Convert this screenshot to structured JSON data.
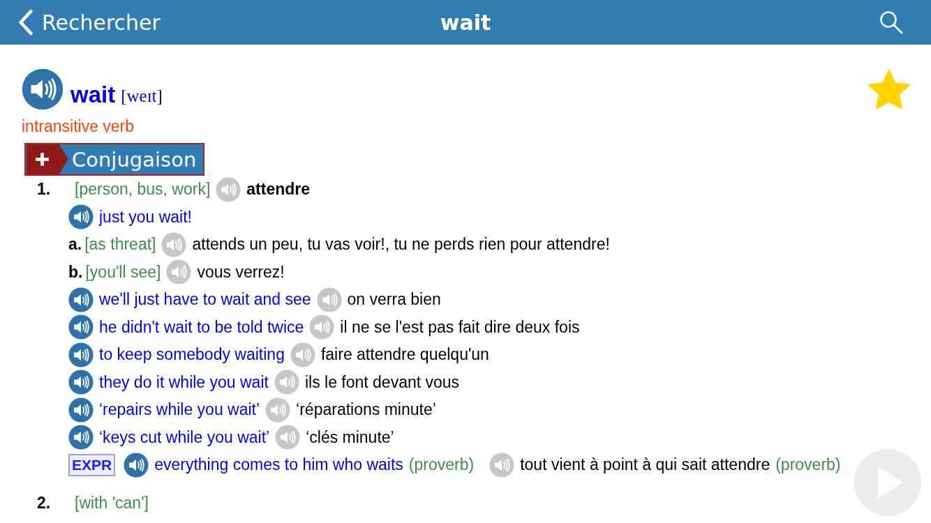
{
  "header": {
    "back_label": "Rechercher",
    "title": "wait"
  },
  "entry": {
    "headword": "wait",
    "pronunciation": "[weɪt]",
    "part_of_speech": "intransitive verb",
    "conjugation_button": "Conjugaison",
    "favorite": true
  },
  "senses": [
    {
      "number": "1.",
      "context": "[person, bus, work]",
      "translation": "attendre",
      "lines": [
        {
          "kind": "example",
          "source": "just you wait!"
        },
        {
          "kind": "sub",
          "letter": "a.",
          "context": "[as threat]",
          "translation": "attends un peu, tu vas voir!, tu ne perds rien pour attendre!"
        },
        {
          "kind": "sub",
          "letter": "b.",
          "context": "[you'll see]",
          "translation": "vous verrez!"
        },
        {
          "kind": "example",
          "source": "we'll just have to wait and see",
          "translation": "on verra bien"
        },
        {
          "kind": "example",
          "source": "he didn't wait to be told twice",
          "translation": "il ne se l'est pas fait dire deux fois"
        },
        {
          "kind": "example",
          "source": "to keep somebody waiting",
          "translation": "faire attendre quelqu'un"
        },
        {
          "kind": "example",
          "source": "they do it while you wait",
          "translation": "ils le font devant vous"
        },
        {
          "kind": "example",
          "source": "‘repairs while you wait’",
          "translation": "‘réparations minute’"
        },
        {
          "kind": "example",
          "source": "‘keys cut while you wait’",
          "translation": "‘clés minute’"
        },
        {
          "kind": "expression",
          "badge": "EXPR",
          "source": "everything comes to him who waits",
          "source_note": "(proverb)",
          "translation": "tout vient à point à qui sait attendre",
          "translation_note": "(proverb)"
        }
      ]
    },
    {
      "number": "2.",
      "context": "[with 'can']"
    }
  ]
}
